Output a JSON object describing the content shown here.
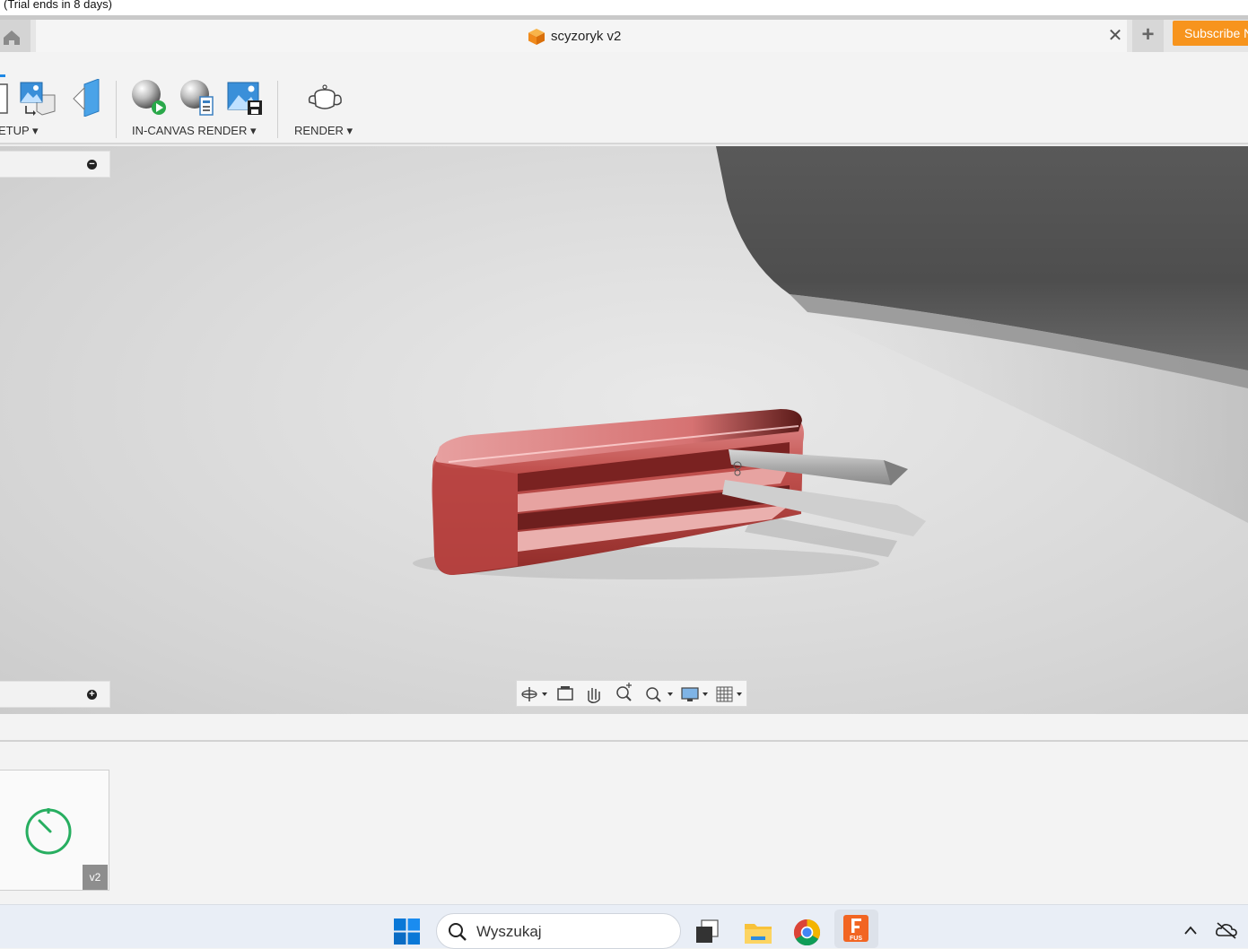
{
  "app": {
    "trial_text": "(Trial ends in 8 days)",
    "doc_title": "scyzoryk v2",
    "close_glyph": "✕",
    "new_tab_glyph": "+",
    "subscribe_label": "Subscribe N"
  },
  "toolbar": {
    "groups": [
      {
        "label": "ETUP",
        "icons": [
          "scene-settings-icon",
          "environment-library-icon",
          "texture-map-icon"
        ]
      },
      {
        "label": "IN-CANVAS RENDER",
        "icons": [
          "in-canvas-render-icon",
          "in-canvas-render-settings-icon",
          "capture-image-icon"
        ]
      },
      {
        "label": "RENDER",
        "icons": [
          "render-teapot-icon"
        ]
      }
    ]
  },
  "viewport": {
    "panel_top_glyph": "−",
    "panel_bottom_glyph": "+",
    "nav_tools": [
      "orbit-icon",
      "look-at-icon",
      "pan-icon",
      "zoom-icon",
      "fit-icon",
      "display-settings-icon",
      "grid-settings-icon"
    ]
  },
  "history": {
    "version_label": "v2"
  },
  "taskbar": {
    "search_placeholder": "Wyszukaj",
    "apps": [
      "windows-start-icon",
      "search-icon",
      "task-view-icon",
      "file-explorer-icon",
      "chrome-icon",
      "fusion-icon"
    ],
    "fusion_badge": "FUS"
  },
  "colors": {
    "subscribe": "#f7941d",
    "model_red": "#c0392b",
    "timer_green": "#27ae60"
  }
}
